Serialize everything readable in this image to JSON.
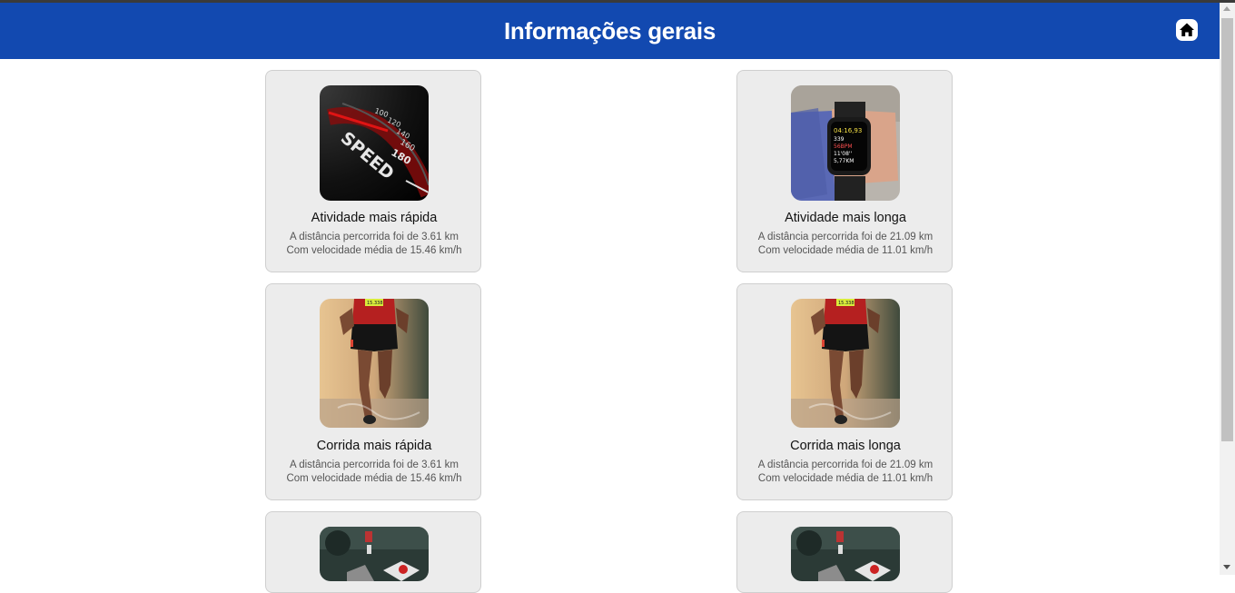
{
  "header": {
    "title": "Informações gerais",
    "home_icon": "home-icon"
  },
  "colors": {
    "header_bg": "#1249b0",
    "card_bg": "#ececec"
  },
  "cards": [
    {
      "title": "Atividade mais rápida",
      "line1": "A distância percorrida foi de 3.61 km",
      "line2": "Com velocidade média de 15.46 km/h",
      "image": "speedometer-image",
      "speedo_marks": [
        "100",
        "120",
        "140",
        "160",
        "180"
      ],
      "speedo_word": "SPEED"
    },
    {
      "title": "Atividade mais longa",
      "line1": "A distância percorrida foi de 21.09 km",
      "line2": "Com velocidade média de 11.01 km/h",
      "image": "smartwatch-image",
      "watch_lines": [
        "04:16,93",
        "339",
        "56BPM",
        "11'08''",
        "5,77KM"
      ]
    },
    {
      "title": "Corrida mais rápida",
      "line1": "A distância percorrida foi de 3.61 km",
      "line2": "Com velocidade média de 15.46 km/h",
      "image": "runner-image",
      "bib": "15.338"
    },
    {
      "title": "Corrida mais longa",
      "line1": "A distância percorrida foi de 21.09 km",
      "line2": "Com velocidade média de 11.01 km/h",
      "image": "runner-image",
      "bib": "15.338"
    },
    {
      "image": "cyclist-image"
    },
    {
      "image": "cyclist-image"
    }
  ]
}
